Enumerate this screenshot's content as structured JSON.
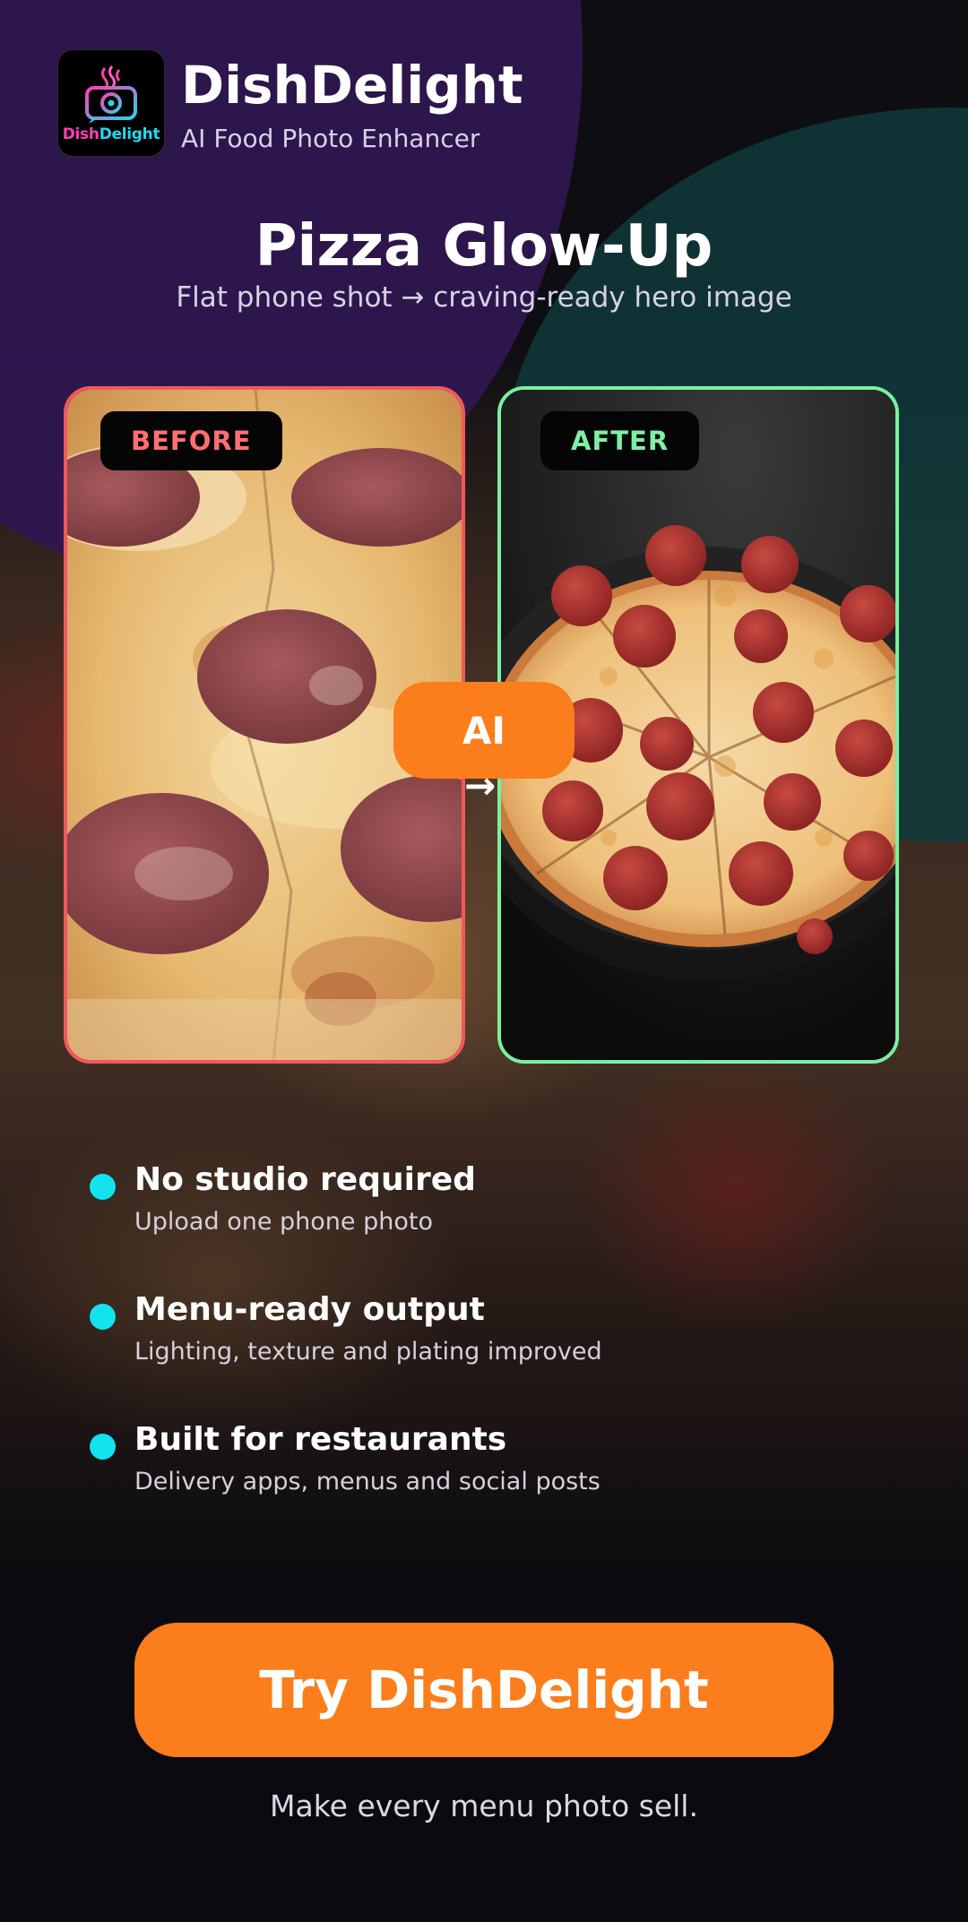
{
  "app": {
    "logo_text_a": "Dish",
    "logo_text_b": "Delight",
    "name": "DishDelight",
    "tagline": "AI Food Photo Enhancer"
  },
  "hero": {
    "title": "Pizza Glow-Up",
    "subtitle": "Flat phone shot → craving-ready hero image"
  },
  "comparison": {
    "before_label": "BEFORE",
    "after_label": "AFTER",
    "badge_label": "AI",
    "arrow": "→",
    "before_image": "close-up flat pepperoni pizza photo",
    "after_image": "enhanced whole pepperoni pizza on dark pan"
  },
  "features": [
    {
      "title": "No studio required",
      "subtitle": "Upload one phone photo"
    },
    {
      "title": "Menu-ready output",
      "subtitle": "Lighting, texture and plating improved"
    },
    {
      "title": "Built for restaurants",
      "subtitle": "Delivery apps, menus and social posts"
    }
  ],
  "cta": {
    "label": "Try DishDelight"
  },
  "footer": {
    "text": "Make every menu photo sell."
  },
  "colors": {
    "accent": "#fb7d1c",
    "before_border": "#f0585e",
    "after_border": "#7bf0a0",
    "feature_dot": "#12e3ef",
    "bg_purple": "#2f1750",
    "bg_teal": "#0f3a3c"
  }
}
